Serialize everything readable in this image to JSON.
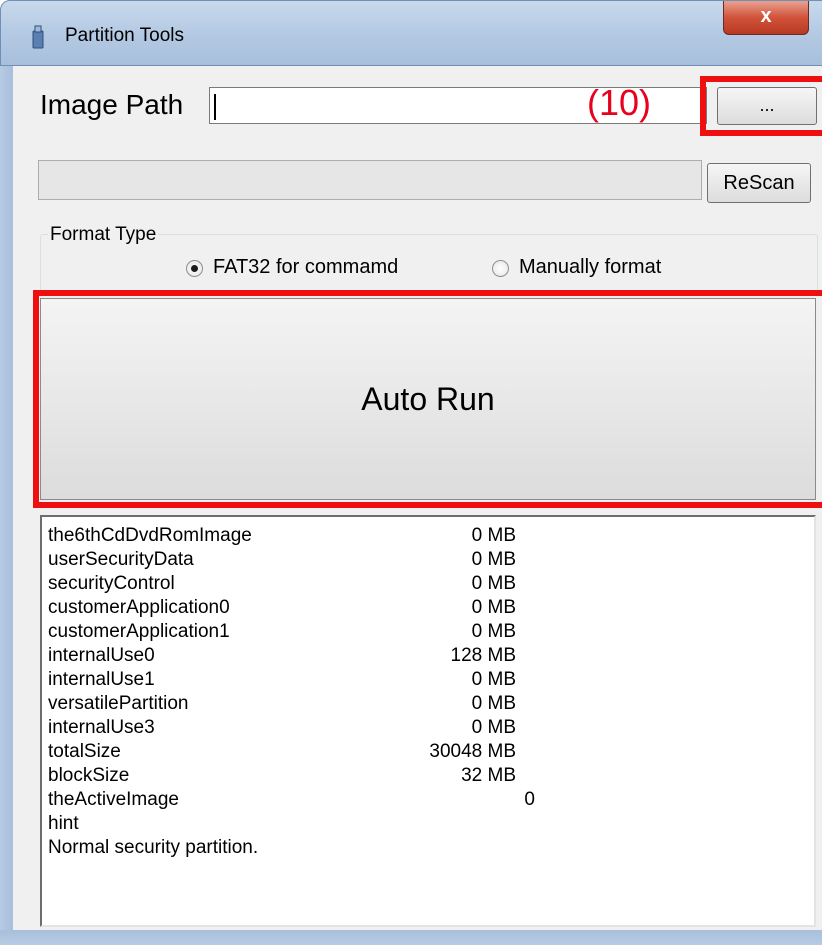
{
  "window": {
    "title": "Partition Tools",
    "close_label": "x"
  },
  "image_path": {
    "label": "Image Path",
    "value": "",
    "browse_label": "..."
  },
  "annotations": {
    "browse": "(10)"
  },
  "rescan_label": "ReScan",
  "format_type": {
    "legend": "Format Type",
    "options": [
      {
        "label": "FAT32  for commamd",
        "selected": true
      },
      {
        "label": "Manually format",
        "selected": false
      }
    ]
  },
  "autorun_label": "Auto Run",
  "info_rows": [
    {
      "name": "the6thCdDvdRomImage",
      "value": "0 MB"
    },
    {
      "name": "userSecurityData",
      "value": "0 MB"
    },
    {
      "name": "securityControl",
      "value": "0 MB"
    },
    {
      "name": "customerApplication0",
      "value": "0 MB"
    },
    {
      "name": "customerApplication1",
      "value": "0 MB"
    },
    {
      "name": "internalUse0",
      "value": "128 MB"
    },
    {
      "name": "internalUse1",
      "value": "0 MB"
    },
    {
      "name": "versatilePartition",
      "value": "0 MB"
    },
    {
      "name": "internalUse3",
      "value": "0 MB"
    },
    {
      "name": "totalSize",
      "value": "30048 MB"
    },
    {
      "name": "blockSize",
      "value": "32 MB"
    },
    {
      "name": "theActiveImage",
      "value": "0"
    },
    {
      "name": "hint",
      "value": ""
    },
    {
      "name": "Normal security partition.",
      "value": ""
    }
  ],
  "colors": {
    "annotation": "#ee1010",
    "title_bar": "#b6cbe4",
    "close_button": "#d0533a"
  }
}
